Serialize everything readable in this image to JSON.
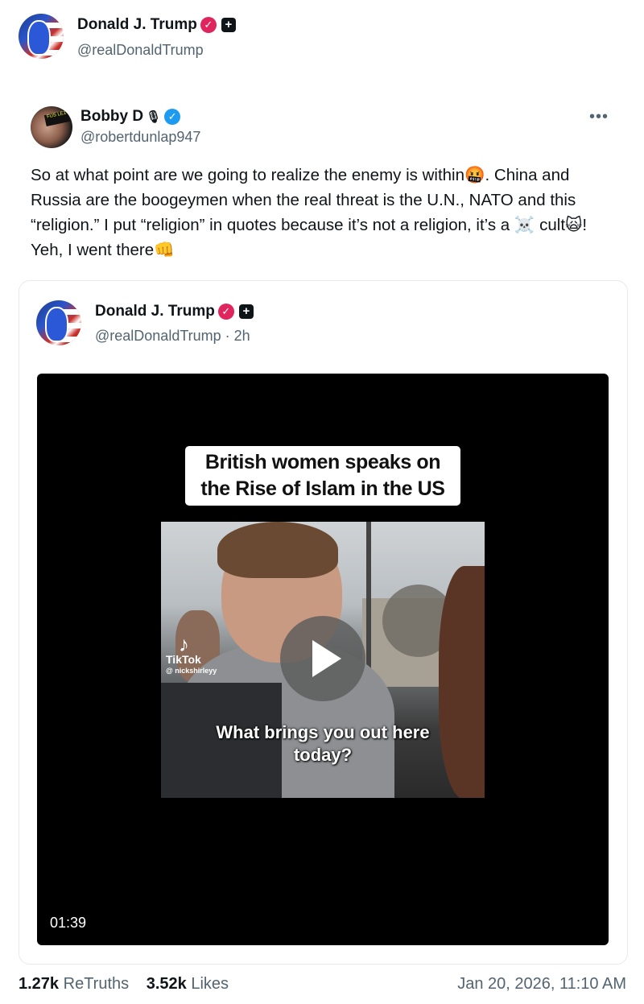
{
  "post": {
    "author_name": "Donald J. Trump",
    "author_handle": "@realDonaldTrump",
    "verified_icon": "check-badge-icon",
    "plus_icon": "plus-badge-icon"
  },
  "quoted": {
    "author_name": "Bobby D",
    "author_handle": "@robertdunlap947",
    "more_icon": "ellipsis-icon",
    "text": "So at what point are we going to realize the enemy is within🤬. China and Russia are the boogeymen when the real threat is the U.N., NATO and this “religion.” I put “religion” in quotes because it’s not a religion, it’s a ☠️ cult🙀! Yeh, I went there👊"
  },
  "card": {
    "author_name": "Donald J. Trump",
    "author_handle_time": "@realDonaldTrump · 2h",
    "video": {
      "caption": "British women speaks on\nthe Rise of Islam in the US",
      "tiktok_brand": "TikTok",
      "tiktok_user": "@ nickshirleyy",
      "subtitle": "What brings you out here\ntoday?",
      "duration": "01:39",
      "play_icon": "play-icon"
    }
  },
  "stats": {
    "retruths_count": "1.27k",
    "retruths_label": "ReTruths",
    "likes_count": "3.52k",
    "likes_label": "Likes",
    "date": "Jan 20, 2026, 11:10 AM"
  },
  "colors": {
    "verified_red": "#e0245e",
    "verified_blue": "#1d9bf0",
    "muted_text": "#536471"
  }
}
